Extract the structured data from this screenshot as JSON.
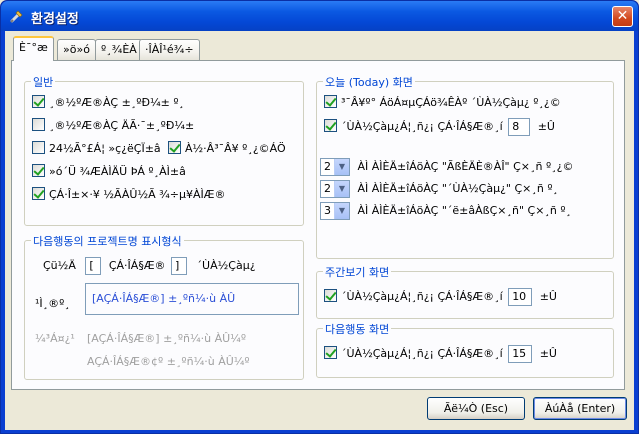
{
  "window": {
    "title": "환경설정",
    "close_glyph": "✕"
  },
  "tabs": [
    {
      "label": "È¯°æ"
    },
    {
      "label": "»ö»ó"
    },
    {
      "label": "º¸¾ÈÀ"
    },
    {
      "label": "·ÎÀÎ¹é¾÷"
    }
  ],
  "general": {
    "legend": "일반",
    "opt1": "¸®½ºÆ®ÀÇ ±¸ºÐ¼± º¸",
    "opt2": "¸®½ºÆ®ÀÇ ÄÃ·¯±¸ºÐ¼±",
    "opt3": "24½Ã°£Á¦ »ç¿ëÇÏ±â",
    "opt3b": "À½·Â³¯Â¥ º¸¿©ÁÖ",
    "opt4": "»ó´Ü ¾ÆÀÌÄÜ ÞÁ º¸ÀÌ±â",
    "opt5": "ÇÁ·Î±×·¥ ½ÃÀÛ½Ã ¾÷µ¥ÀÌÆ®"
  },
  "next_action": {
    "legend": "다음행동의 프로젝트명 표시형식",
    "separator_label": "Çü½Ä",
    "bracket_open": "[",
    "project_label": "ÇÁ·ÎÁ§Æ®",
    "bracket_close": "]",
    "suffix_label": "´ÙÀ½Çàµ¿",
    "example_label": "¹Ì¸®º¸",
    "example_value": "[AÇÁ·ÎÁ§Æ®] ±¸ºñ¼­·ù ÀÛ",
    "sub_label": "¼³Á¤¿¹",
    "sub_value1": "[AÇÁ·ÎÁ§Æ®] ±¸ºñ¼­·ù ÀÛ¼º",
    "sub_value2": "AÇÁ·ÎÁ§Æ®¢º ±¸ºñ¼­·ù ÀÛ¼º"
  },
  "today": {
    "legend": "오늘 (Today) 화면",
    "opt1": "³¯Â¥º° ÁöÁ¤µÇÁö¾ÊÀº ´ÙÀ½Çàµ¿ º¸¿©",
    "opt2_pre": "´ÙÀ½Çàµ¿Á¦¸ñ¿¡ ÇÁ·ÎÁ§Æ®¸í",
    "opt2_value": "8",
    "opt2_suf": "±Û",
    "combo1_value": "2",
    "combo1_text": "ÀÌ ÀÌÈÄ±îÁöÀÇ \"ÃßÈÄÈ®ÀÎ\" Ç×¸ñ º¸¿©",
    "combo2_value": "2",
    "combo2_text": "ÀÌ ÀÌÈÄ±îÁöÀÇ \"´ÙÀ½Çàµ¿\" Ç×¸ñ º¸",
    "combo3_value": "3",
    "combo3_text": "ÀÌ ÀÌÈÄ±îÁöÀÇ \"´ë±âÀßÇ×¸ñ\" Ç×¸ñ º¸"
  },
  "weekly": {
    "legend": "주간보기 화면",
    "opt_pre": "´ÙÀ½Çàµ¿Á¦¸ñ¿¡ ÇÁ·ÎÁ§Æ®¸í",
    "opt_value": "10",
    "opt_suf": "±Û"
  },
  "next_screen": {
    "legend": "다음행동 화면",
    "opt_pre": "´ÙÀ½Çàµ¿Á¦¸ñ¿¡ ÇÁ·ÎÁ§Æ®¸í",
    "opt_value": "15",
    "opt_suf": "±Û"
  },
  "buttons": {
    "cancel": "Ãë¼Ò (Esc)",
    "ok": "ÀúÀå (Enter)"
  },
  "colors": {
    "legend_text": "#0046d5",
    "titlebar": "#0b59e2",
    "check": "#21a121"
  }
}
